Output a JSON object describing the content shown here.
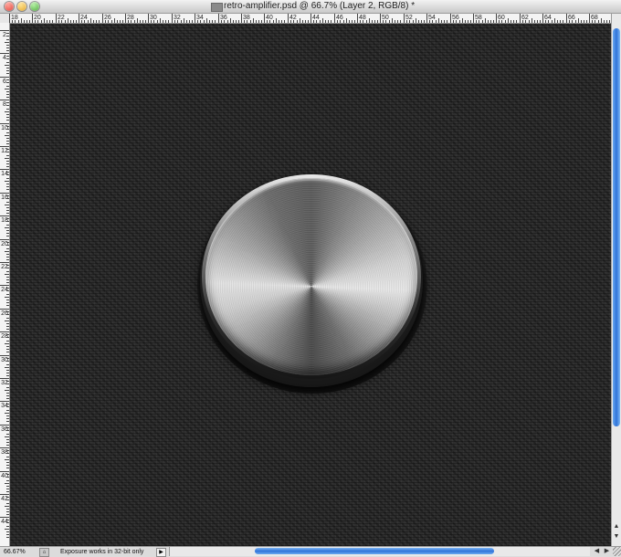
{
  "window": {
    "title": "retro-amplifier.psd @ 66.7% (Layer 2, RGB/8) *"
  },
  "ruler_top": {
    "labels": [
      "18",
      "20",
      "22",
      "24",
      "26",
      "28",
      "30",
      "32",
      "34",
      "36",
      "38",
      "40",
      "42",
      "44",
      "46",
      "48",
      "50",
      "52",
      "54",
      "56",
      "58",
      "60",
      "62",
      "64",
      "66",
      "68"
    ]
  },
  "ruler_left": {
    "labels": [
      "2",
      "4",
      "6",
      "8",
      "10",
      "12",
      "14",
      "16",
      "18",
      "20",
      "22",
      "24",
      "26",
      "28",
      "30",
      "32",
      "34",
      "36",
      "38",
      "40",
      "42",
      "44"
    ]
  },
  "status": {
    "zoom": "66.67%",
    "message": "Exposure works in 32-bit only",
    "menu_glyph": "▶"
  },
  "icons": {
    "close": "close-icon",
    "minimize": "minimize-icon",
    "zoom": "zoom-icon",
    "document": "document-icon"
  },
  "canvas": {
    "background": "#262626",
    "object": "brushed-metal-knob"
  }
}
